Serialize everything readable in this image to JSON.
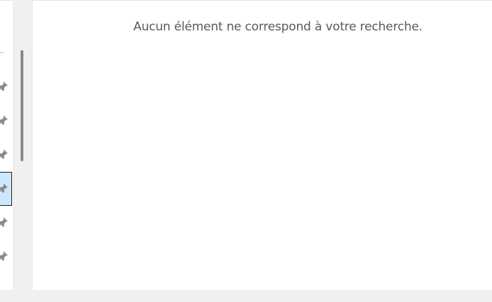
{
  "left_list": {
    "items": [
      {
        "icon": "pin-icon",
        "selected": false
      },
      {
        "icon": "pin-icon",
        "selected": false
      },
      {
        "icon": "pin-icon",
        "selected": false
      },
      {
        "icon": "pin-icon",
        "selected": true
      },
      {
        "icon": "pin-icon",
        "selected": false
      },
      {
        "icon": "pin-icon",
        "selected": false
      }
    ]
  },
  "main": {
    "empty_message": "Aucun élément ne correspond à votre recherche."
  },
  "colors": {
    "selection": "#cce8ff",
    "pin": "#8a8a8a",
    "text": "#5a5a5a"
  }
}
